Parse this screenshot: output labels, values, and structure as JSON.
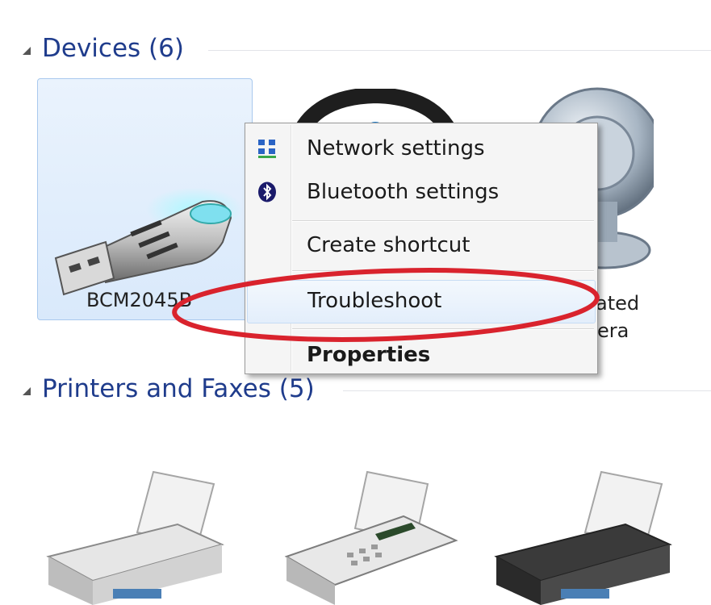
{
  "devices_group": {
    "title": "Devices (6)"
  },
  "printers_group": {
    "title": "Printers and Faxes (5)"
  },
  "devices": [
    {
      "label": "BCM2045B",
      "icon": "usb-bluetooth-dongle-icon"
    },
    {
      "label": "",
      "icon": "headset-icon"
    },
    {
      "label_line1": "ated",
      "label_line2": "era",
      "icon": "webcam-icon"
    }
  ],
  "context_menu": {
    "items": [
      {
        "label": "Network settings",
        "icon": "network-settings-icon"
      },
      {
        "label": "Bluetooth settings",
        "icon": "bluetooth-icon"
      },
      {
        "label": "Create shortcut"
      },
      {
        "label": "Troubleshoot"
      },
      {
        "label": "Properties"
      }
    ]
  },
  "printers": [
    {
      "icon": "printer-icon"
    },
    {
      "icon": "fax-machine-icon"
    },
    {
      "icon": "printer-icon"
    }
  ],
  "colors": {
    "group_title": "#1f3c8c",
    "selection_fill": "#dce9fb",
    "selection_border": "#a9c9ee",
    "highlight_ellipse": "#d9232d"
  }
}
